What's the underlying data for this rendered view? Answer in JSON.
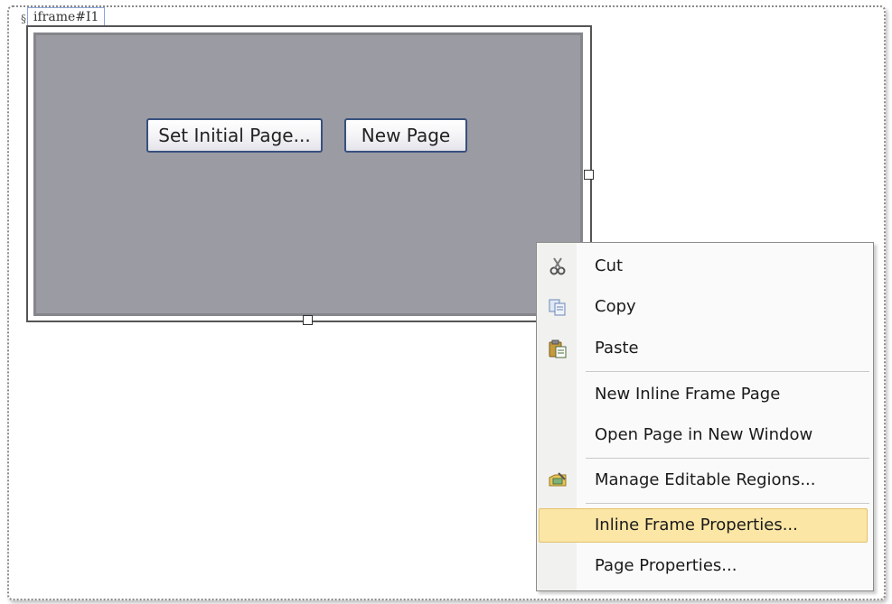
{
  "frame_tag": {
    "label": "iframe#I1"
  },
  "iframe": {
    "set_initial_page_label": "Set Initial Page...",
    "new_page_label": "New Page"
  },
  "context_menu": {
    "items": [
      {
        "label": "Cut",
        "icon": "scissors-icon"
      },
      {
        "label": "Copy",
        "icon": "copy-icon"
      },
      {
        "label": "Paste",
        "icon": "paste-icon"
      },
      {
        "label": "New Inline Frame Page"
      },
      {
        "label": "Open Page in New Window"
      },
      {
        "label": "Manage Editable Regions...",
        "icon": "editable-regions-icon"
      },
      {
        "label": "Inline Frame Properties...",
        "highlighted": true
      },
      {
        "label": "Page Properties..."
      }
    ]
  },
  "colors": {
    "iframe_body": "#9b9ba3",
    "menu_highlight": "#fbe6a5",
    "button_border": "#38517d"
  }
}
